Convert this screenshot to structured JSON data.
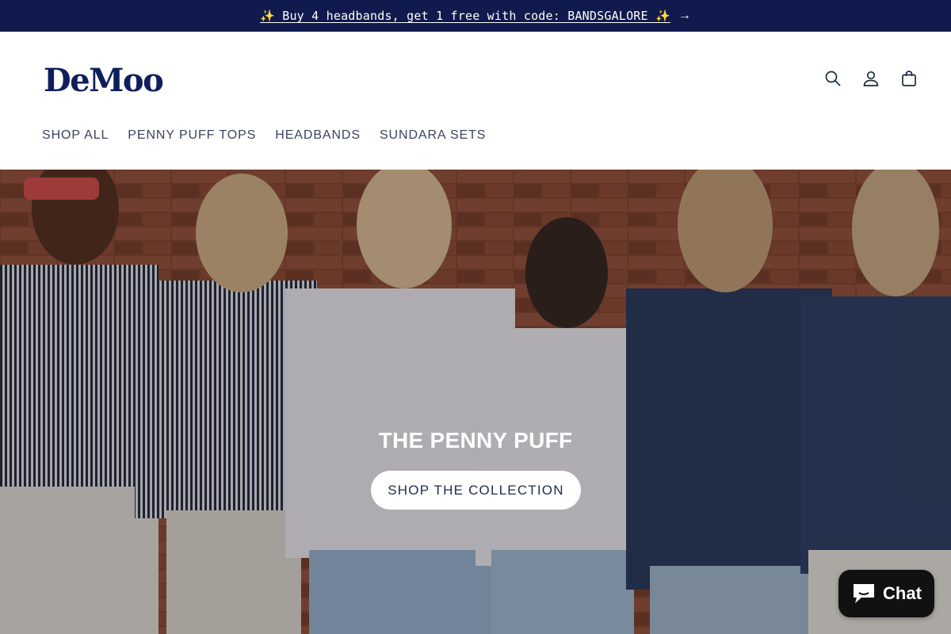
{
  "announcement": {
    "text": "✨ Buy 4 headbands, get 1 free with code: BANDSGALORE ✨",
    "arrow": "→"
  },
  "header": {
    "logo": "DeMoo",
    "icons": [
      "search-icon",
      "account-icon",
      "cart-icon"
    ]
  },
  "nav": {
    "items": [
      {
        "label": "SHOP ALL"
      },
      {
        "label": "PENNY PUFF TOPS"
      },
      {
        "label": "HEADBANDS"
      },
      {
        "label": "SUNDARA SETS"
      }
    ]
  },
  "hero": {
    "title": "THE PENNY PUFF",
    "cta_label": "SHOP THE COLLECTION"
  },
  "chat": {
    "label": "Chat",
    "icon": "chat-bubble-icon"
  },
  "colors": {
    "announcement_bg": "#101a4d",
    "logo": "#0f1e5c",
    "nav_text": "#3a4363",
    "brick": "#8a4a34",
    "chat_bg": "#111111"
  }
}
